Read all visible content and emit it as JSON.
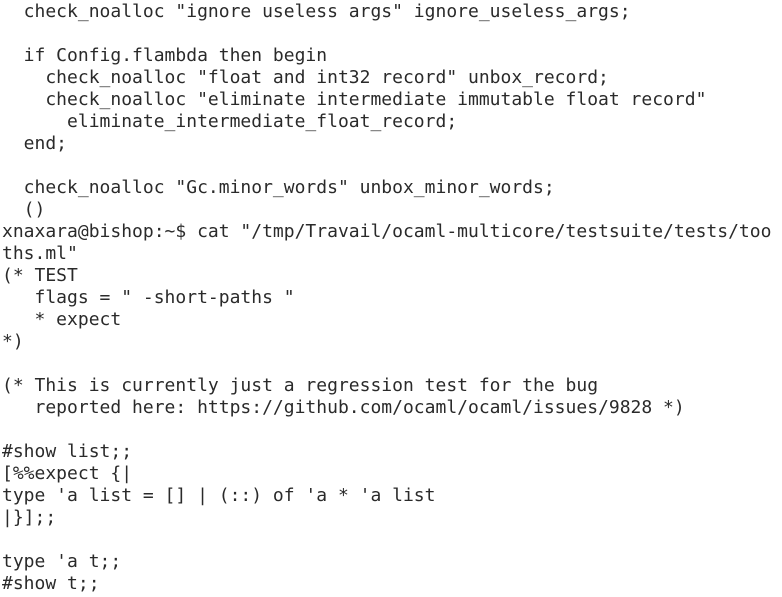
{
  "terminal": {
    "lines": [
      "  check_noalloc \"ignore useless args\" ignore_useless_args;",
      "",
      "  if Config.flambda then begin",
      "    check_noalloc \"float and int32 record\" unbox_record;",
      "    check_noalloc \"eliminate intermediate immutable float record\"",
      "      eliminate_intermediate_float_record;",
      "  end;",
      "",
      "  check_noalloc \"Gc.minor_words\" unbox_minor_words;",
      "  ()",
      "xnaxara@bishop:~$ cat \"/tmp/Travail/ocaml-multicore/testsuite/tests/too",
      "ths.ml\"",
      "(* TEST",
      "   flags = \" -short-paths \"",
      "   * expect",
      "*)",
      "",
      "(* This is currently just a regression test for the bug",
      "   reported here: https://github.com/ocaml/ocaml/issues/9828 *)",
      "",
      "#show list;;",
      "[%%expect {|",
      "type 'a list = [] | (::) of 'a * 'a list",
      "|}];;",
      "",
      "type 'a t;;",
      "#show t;;"
    ]
  }
}
